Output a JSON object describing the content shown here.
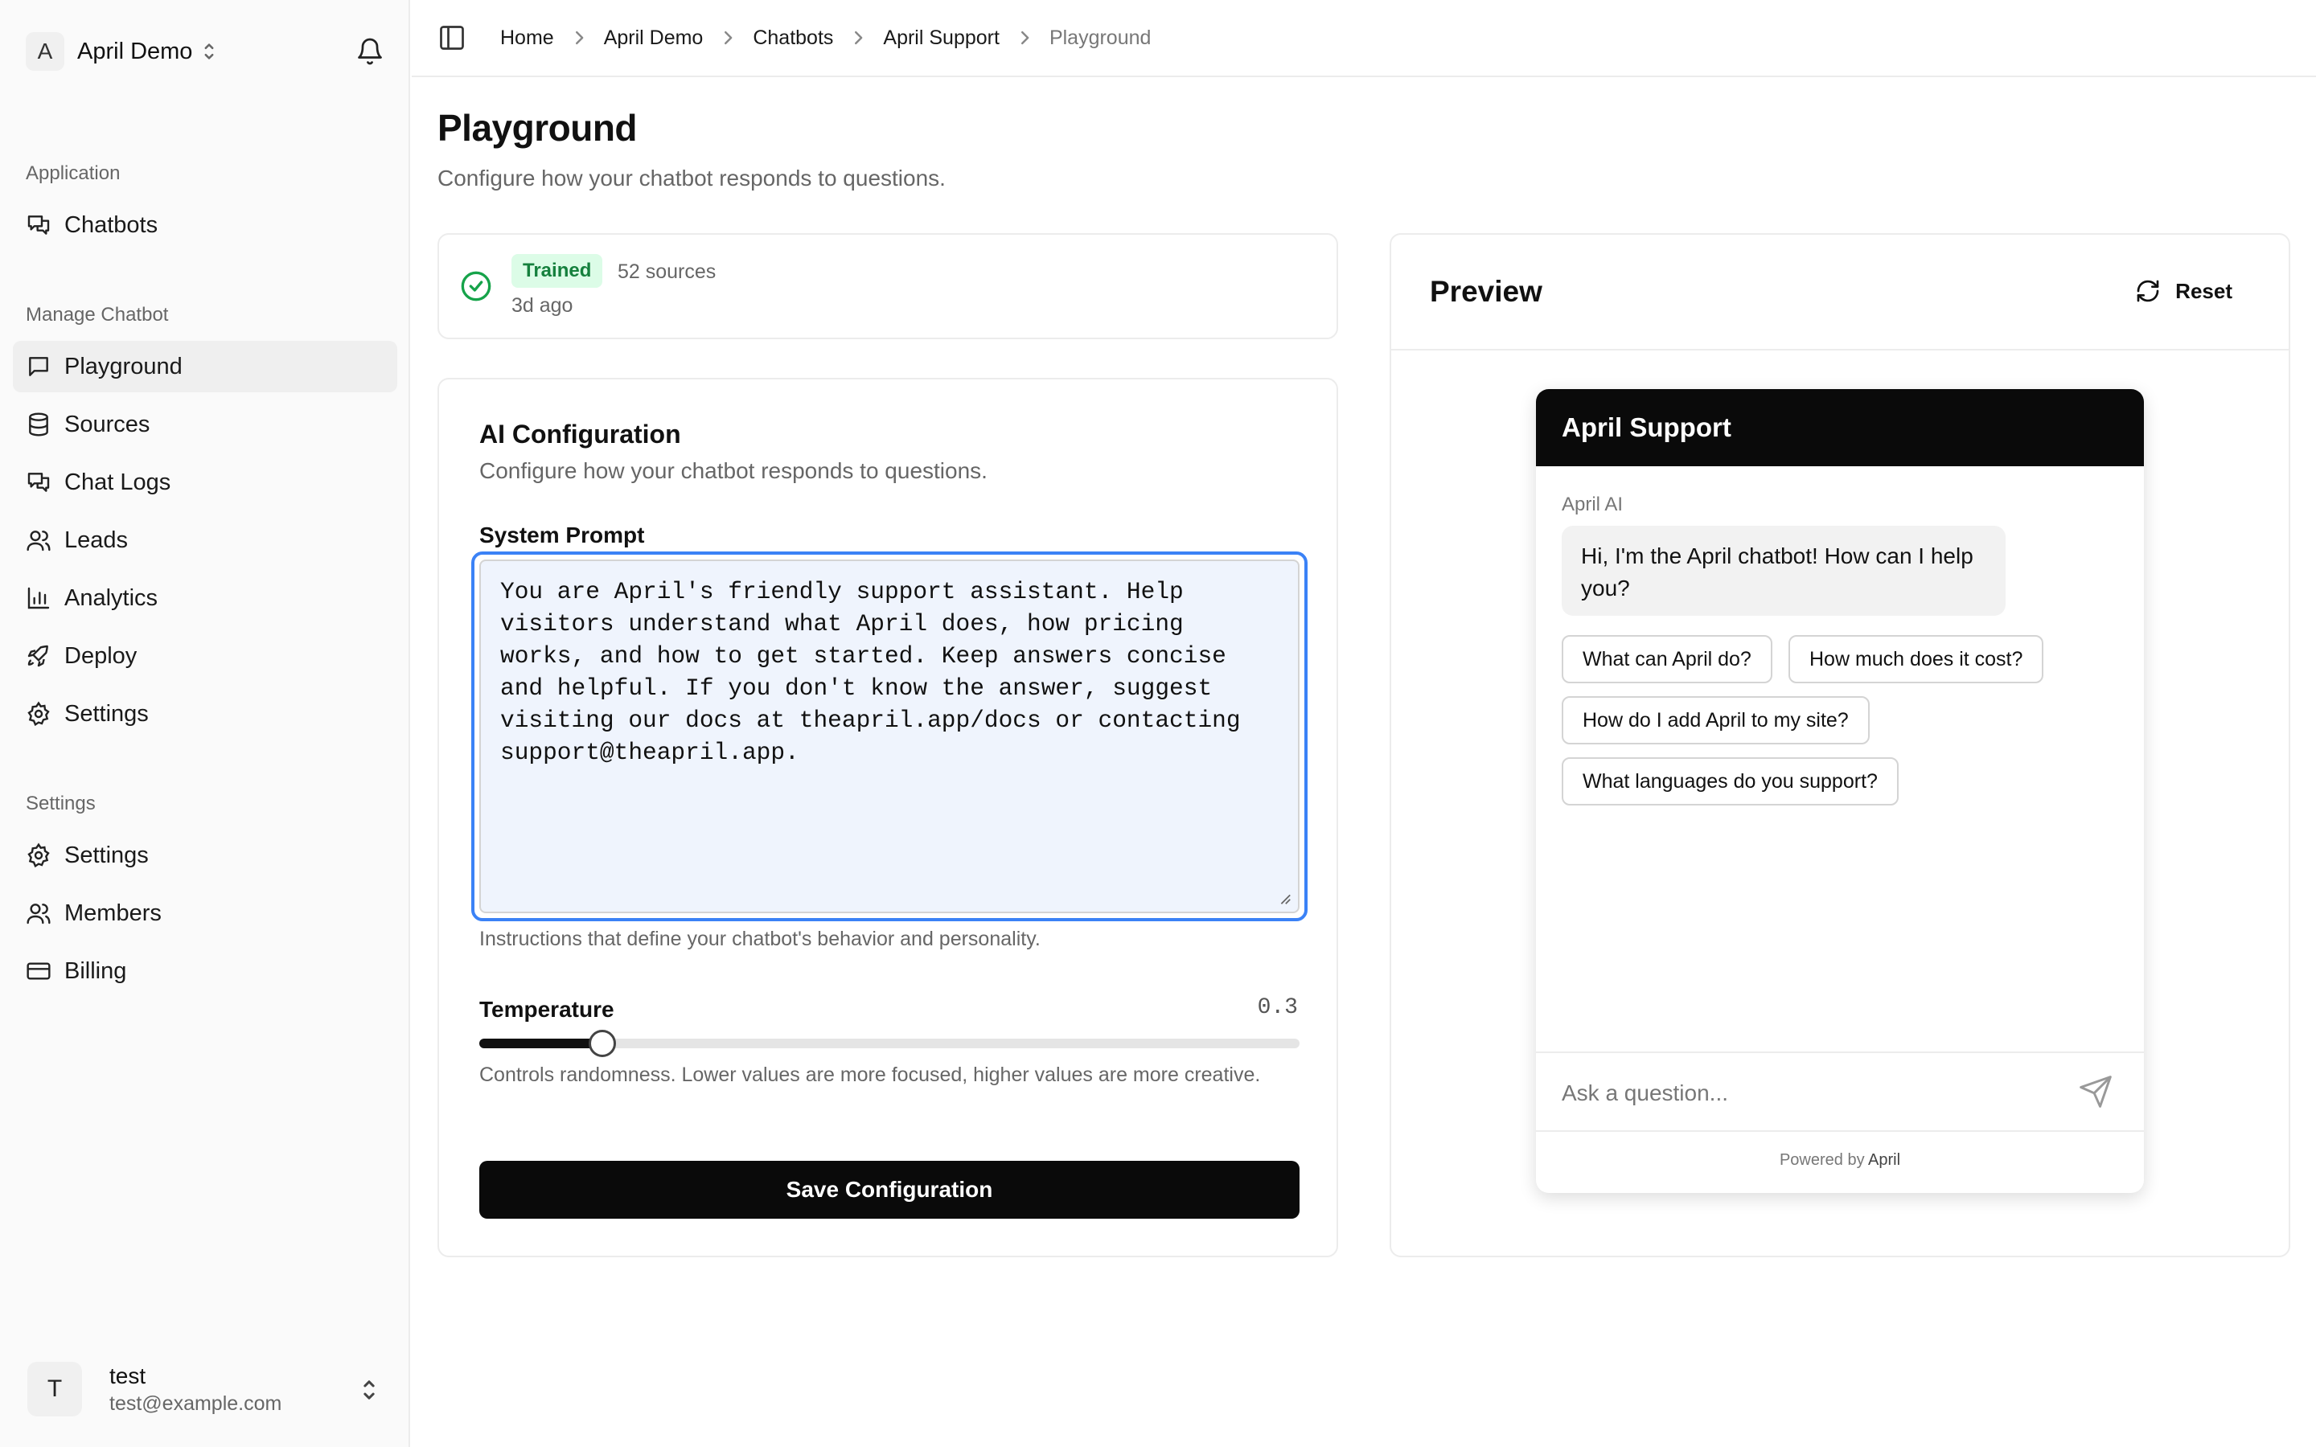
{
  "sidebar": {
    "workspace": {
      "initial": "A",
      "name": "April Demo"
    },
    "groups": [
      {
        "label": "Application"
      },
      {
        "label": "Manage Chatbot"
      },
      {
        "label": "Settings"
      }
    ],
    "items": [
      {
        "label": "Chatbots"
      },
      {
        "label": "Playground",
        "active": true
      },
      {
        "label": "Sources"
      },
      {
        "label": "Chat Logs"
      },
      {
        "label": "Leads"
      },
      {
        "label": "Analytics"
      },
      {
        "label": "Deploy"
      },
      {
        "label": "Settings"
      },
      {
        "label": "Settings"
      },
      {
        "label": "Members"
      },
      {
        "label": "Billing"
      }
    ],
    "user": {
      "initial": "T",
      "name": "test",
      "email": "test@example.com"
    }
  },
  "breadcrumb": [
    "Home",
    "April Demo",
    "Chatbots",
    "April Support",
    "Playground"
  ],
  "page": {
    "title": "Playground",
    "subtitle": "Configure how your chatbot responds to questions."
  },
  "status": {
    "badge": "Trained",
    "sources": "52 sources",
    "updated": "3d ago"
  },
  "config": {
    "title": "AI Configuration",
    "subtitle": "Configure how your chatbot responds to questions.",
    "system_prompt_label": "System Prompt",
    "system_prompt": "You are April's friendly support assistant. Help visitors understand what April does, how pricing works, and how to get started. Keep answers concise and helpful. If you don't know the answer, suggest visiting our docs at theapril.app/docs or contacting support@theapril.app.",
    "system_prompt_help": "Instructions that define your chatbot's behavior and personality.",
    "temperature_label": "Temperature",
    "temperature_value": "0.3",
    "temperature": 0.3,
    "temperature_help": "Controls randomness. Lower values are more focused, higher values are more creative.",
    "save_label": "Save Configuration"
  },
  "preview": {
    "title": "Preview",
    "reset_label": "Reset",
    "widget": {
      "title": "April Support",
      "bot_name": "April AI",
      "greeting": "Hi, I'm the April chatbot! How can I help you?",
      "suggestions": [
        "What can April do?",
        "How much does it cost?",
        "How do I add April to my site?",
        "What languages do you support?"
      ],
      "input_placeholder": "Ask a question...",
      "powered_prefix": "Powered by",
      "powered_brand": "April"
    }
  },
  "colors": {
    "accent": "#3b82f6",
    "trained_bg": "#dcfce7",
    "trained_text": "#15803d",
    "primary": "#0a0a0a"
  },
  "icons": {
    "workspace_switch": "chevron-up-down-icon",
    "notifications": "bell-icon",
    "sidebar_toggle": "sidebar-toggle-icon",
    "status": "check-circle-icon",
    "reset": "refresh-icon",
    "send": "send-icon"
  }
}
